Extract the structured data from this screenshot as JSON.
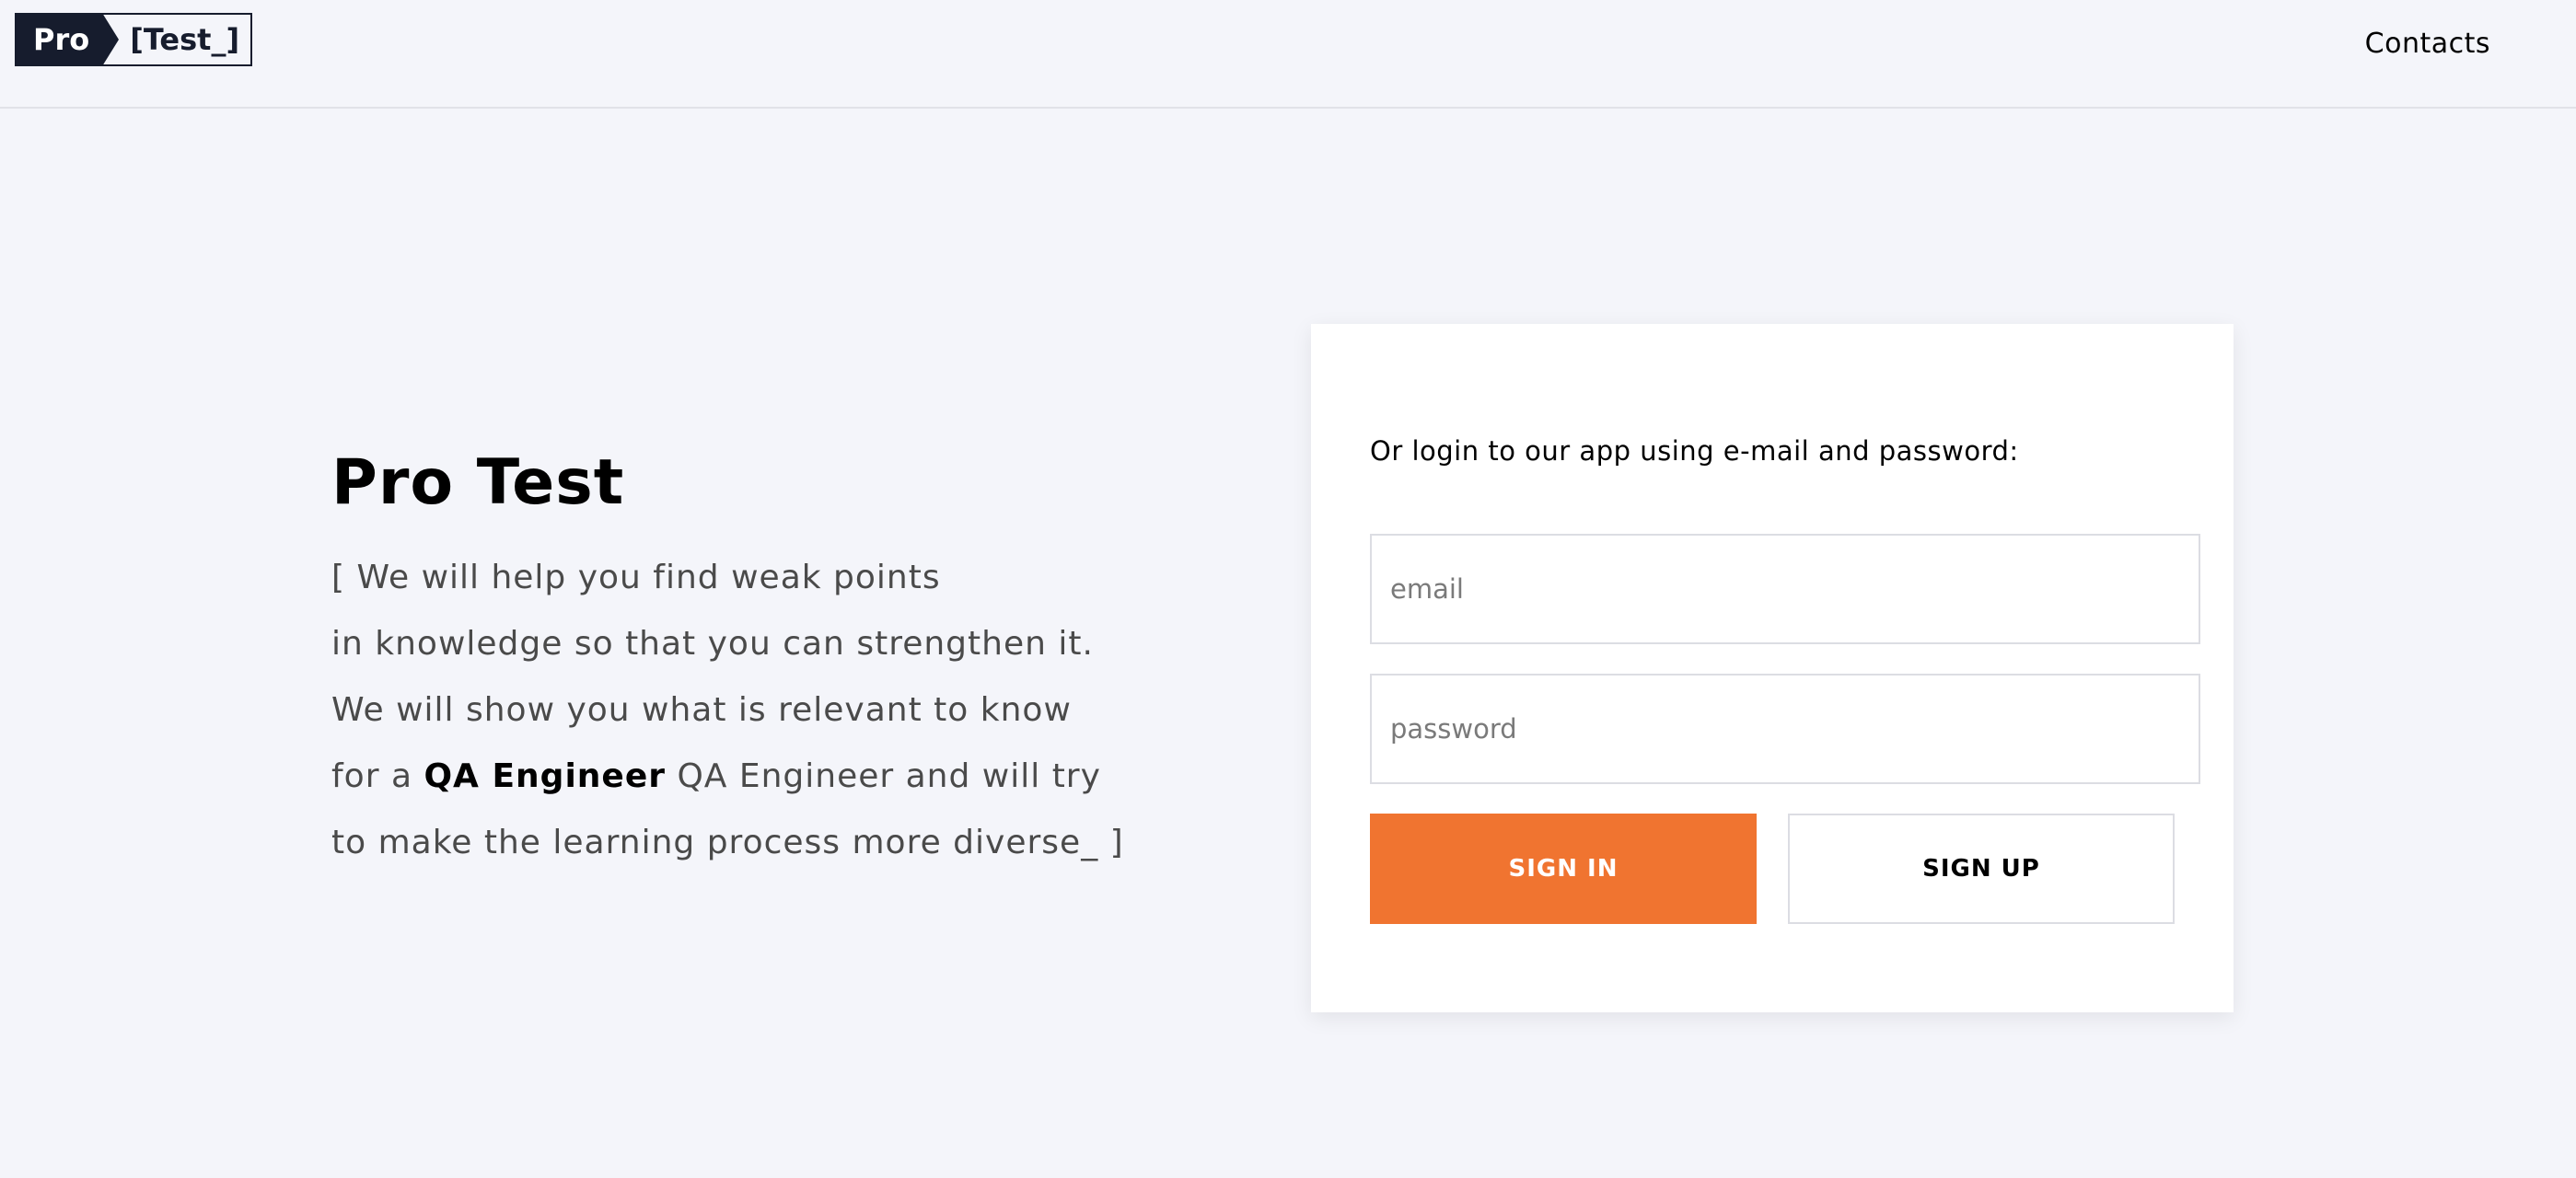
{
  "header": {
    "logo_left": "Pro",
    "logo_right": "[Test_]",
    "nav_contacts": "Contacts"
  },
  "hero": {
    "title": "Pro Test",
    "line1": "[ We will help you find weak points",
    "line2": "in knowledge so that you can strengthen it.",
    "line3": "We will show you what is relevant to know",
    "line4_prefix": "for a ",
    "line4_highlight": "QA Engineer",
    "line4_suffix": " QA Engineer and will try",
    "line5": "to make the learning process more diverse_ ]"
  },
  "login": {
    "intro": "Or login to our app using e-mail and password:",
    "email_placeholder": "email",
    "password_placeholder": "password",
    "signin_label": "SIGN IN",
    "signup_label": "SIGN UP"
  },
  "colors": {
    "background": "#f4f5fa",
    "accent": "#f07430",
    "logo_dark": "#161c2d"
  }
}
